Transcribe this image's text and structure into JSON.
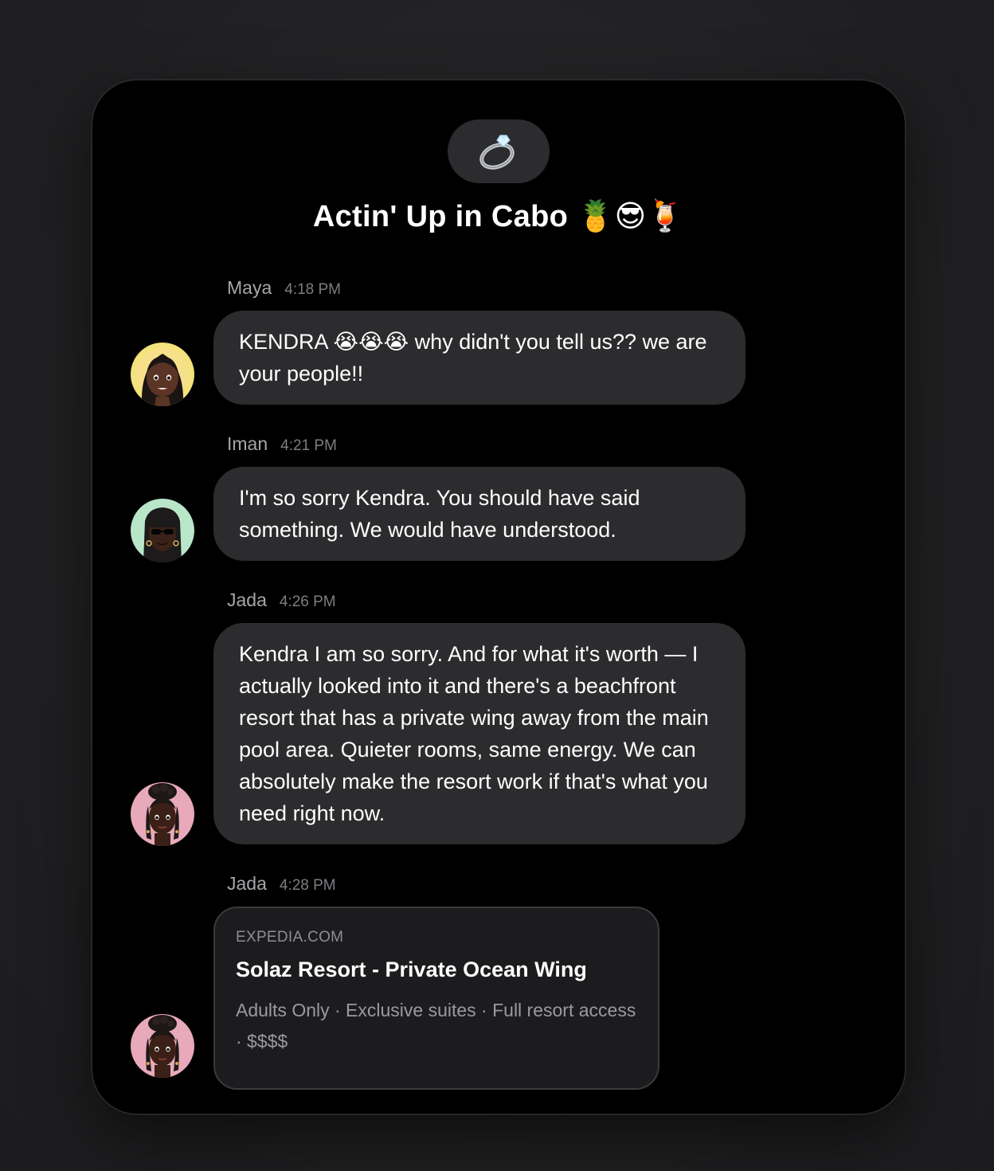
{
  "chat": {
    "group_icon": "ring-emoji",
    "title": "Actin' Up in Cabo 🍍😎🍹",
    "messages": [
      {
        "sender": "Maya",
        "time": "4:18 PM",
        "text": "KENDRA 😭😭😭 why didn't you tell us?? we are your people!!",
        "avatar": "maya-avatar",
        "avatar_color": "#f4e27c"
      },
      {
        "sender": "Iman",
        "time": "4:21 PM",
        "text": "I'm so sorry Kendra. You should have said something. We would have understood.",
        "avatar": "iman-avatar",
        "avatar_color": "#b9e6c8"
      },
      {
        "sender": "Jada",
        "time": "4:26 PM",
        "text": "Kendra I am so sorry. And for what it's worth — I actually looked into it and there's a beachfront resort that has a private wing away from the main pool area. Quieter rooms, same energy. We can absolutely make the resort work if that's what you need right now.",
        "avatar": "jada-avatar",
        "avatar_color": "#e8a9bb"
      },
      {
        "sender": "Jada",
        "time": "4:28 PM",
        "avatar": "jada-avatar",
        "avatar_color": "#e8a9bb",
        "link": {
          "domain": "EXPEDIA.COM",
          "title": "Solaz Resort - Private Ocean Wing",
          "description": "Adults Only · Exclusive suites · Full resort access · $$$$"
        }
      }
    ]
  }
}
